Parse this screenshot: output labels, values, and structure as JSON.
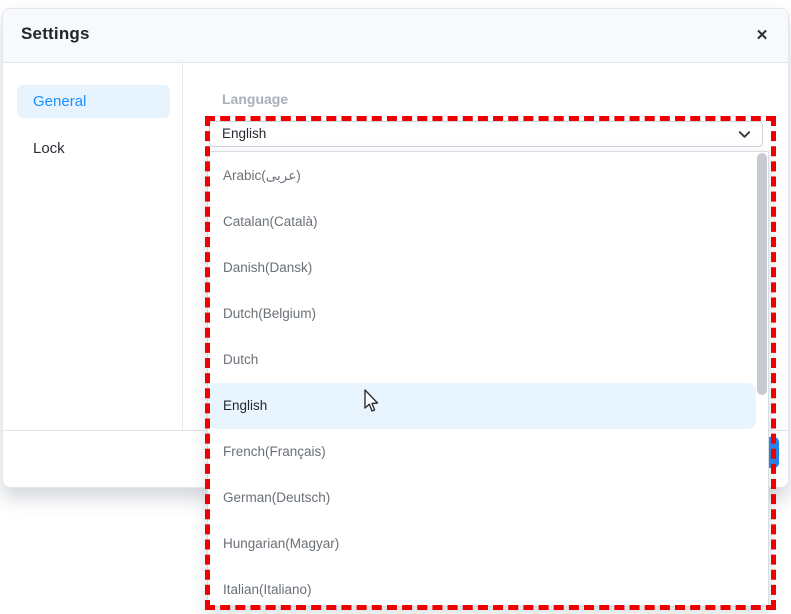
{
  "dialog": {
    "title": "Settings",
    "close_icon": "✕"
  },
  "sidebar": {
    "items": [
      {
        "label": "General",
        "active": true
      },
      {
        "label": "Lock",
        "active": false
      }
    ]
  },
  "main": {
    "language_label": "Language",
    "select": {
      "value": "English"
    },
    "dropdown": {
      "options": [
        "Arabic(عربى)",
        "Catalan(Català)",
        "Danish(Dansk)",
        "Dutch(Belgium)",
        "Dutch",
        "English",
        "French(Français)",
        "German(Deutsch)",
        "Hungarian(Magyar)",
        "Italian(Italiano)"
      ],
      "selected_option": "English"
    }
  },
  "colors": {
    "accent_blue": "#1890ff",
    "active_item_bg": "#e8f4fd",
    "selected_row_bg": "#e9f5fe",
    "primary_button_blue": "#1f82f2",
    "annotation_red": "#ee0000"
  }
}
